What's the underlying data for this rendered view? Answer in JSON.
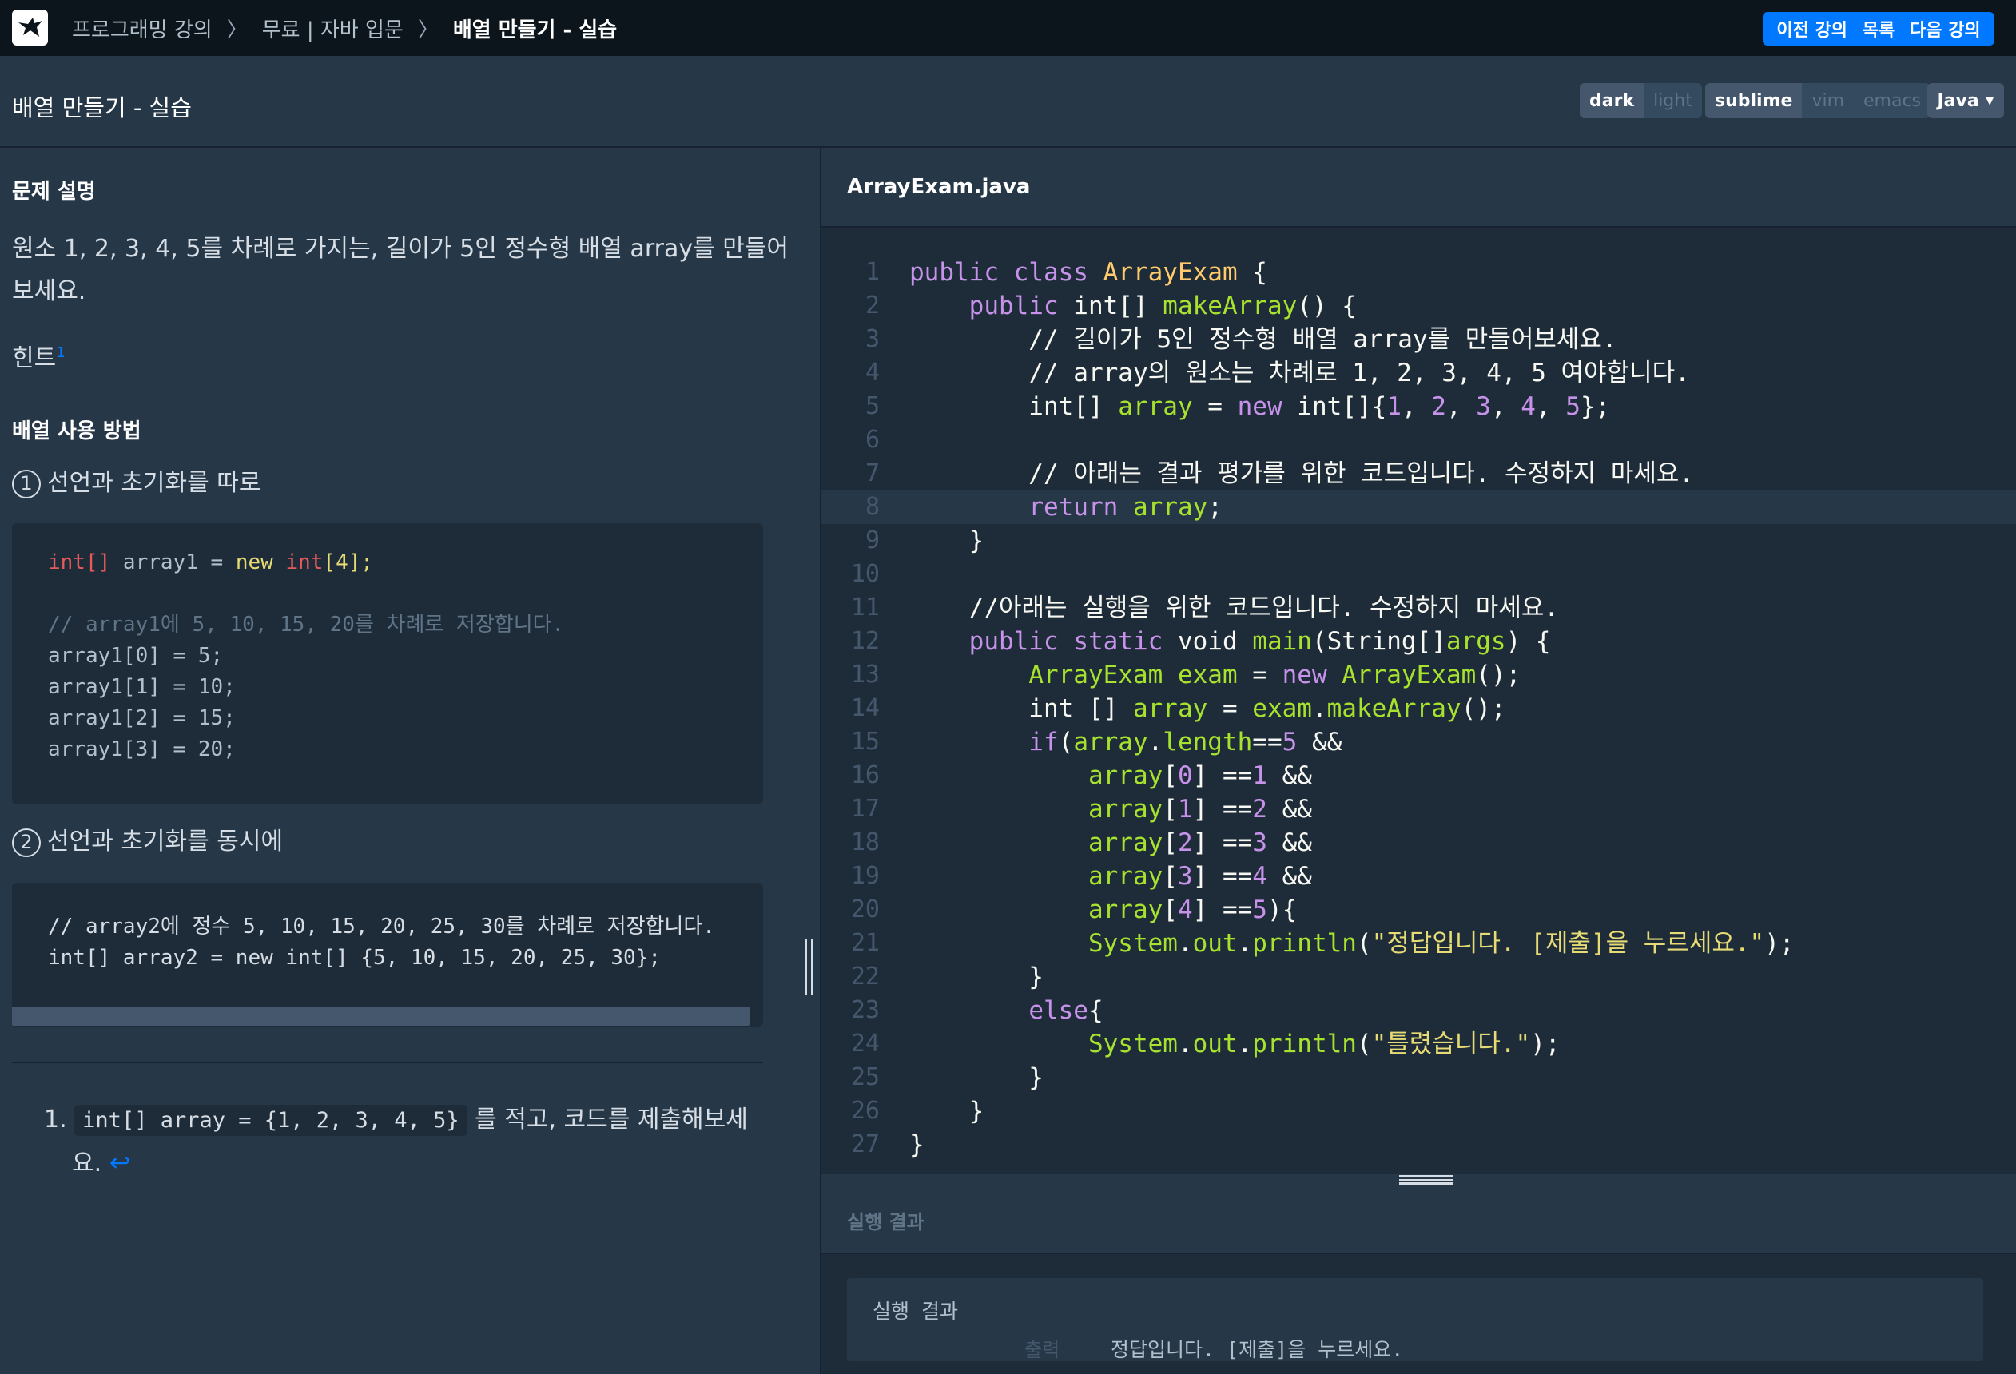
{
  "breadcrumb": {
    "items": [
      "프로그래밍 강의",
      "무료 | 자바 입문",
      "배열 만들기 - 실습"
    ]
  },
  "nav": {
    "prev": "이전 강의",
    "list": "목록",
    "next": "다음 강의"
  },
  "title": "배열 만들기 - 실습",
  "toolbar": {
    "theme": [
      "dark",
      "light"
    ],
    "keymap": [
      "sublime",
      "vim",
      "emacs"
    ],
    "language": "Java"
  },
  "problem": {
    "heading": "문제 설명",
    "description_line1": "원소 1, 2, 3, 4, 5를 차례로 가지는, 길이가 5인 정수형 배열 array를 만들어",
    "description_line2": "보세요.",
    "hint": "힌트",
    "hint_sup": "1",
    "usage_heading": "배열 사용 방법",
    "step1_num": "1",
    "step1": "선언과 초기화를 따로",
    "step2_num": "2",
    "step2": "선언과 초기화를 동시에",
    "code1": {
      "l1_type": "int[]",
      "l1_rest": " array1 = ",
      "l1_new": "new",
      "l1_sp": " ",
      "l1_int": "int",
      "l1_br": "[4];",
      "comment": "// array1에 5, 10, 15, 20를 차례로 저장합니다.",
      "a0": "array1[0] = 5;",
      "a1": "array1[1] = 10;",
      "a2": "array1[2] = 15;",
      "a3": "array1[3] = 20;"
    },
    "code2": {
      "comment": "// array2에 정수 5, 10, 15, 20, 25, 30를 차례로 저장합니다.",
      "line": "int[] array2 = new int[] {5, 10, 15, 20, 25, 30};"
    },
    "footnote_num": "1.",
    "footnote_code": "int[] array = {1, 2, 3, 4, 5}",
    "footnote_text1": " 를 적고, 코드를 제출해보세",
    "footnote_text2": "요.",
    "footnote_icon": "↩"
  },
  "editor": {
    "filename": "ArrayExam.java",
    "line_numbers": [
      "1",
      "2",
      "3",
      "4",
      "5",
      "6",
      "7",
      "8",
      "9",
      "10",
      "11",
      "12",
      "13",
      "14",
      "15",
      "16",
      "17",
      "18",
      "19",
      "20",
      "21",
      "22",
      "23",
      "24",
      "25",
      "26",
      "27"
    ],
    "active_line": 8
  },
  "result": {
    "header": "실행 결과",
    "label": "실행 결과",
    "output_label": "출력",
    "output": "정답입니다. [제출]을 누르세요."
  },
  "colors": {
    "background": "#263747",
    "editor_bg": "#1e2c3a",
    "accent": "#0078ff",
    "topbar": "#0c151c"
  }
}
